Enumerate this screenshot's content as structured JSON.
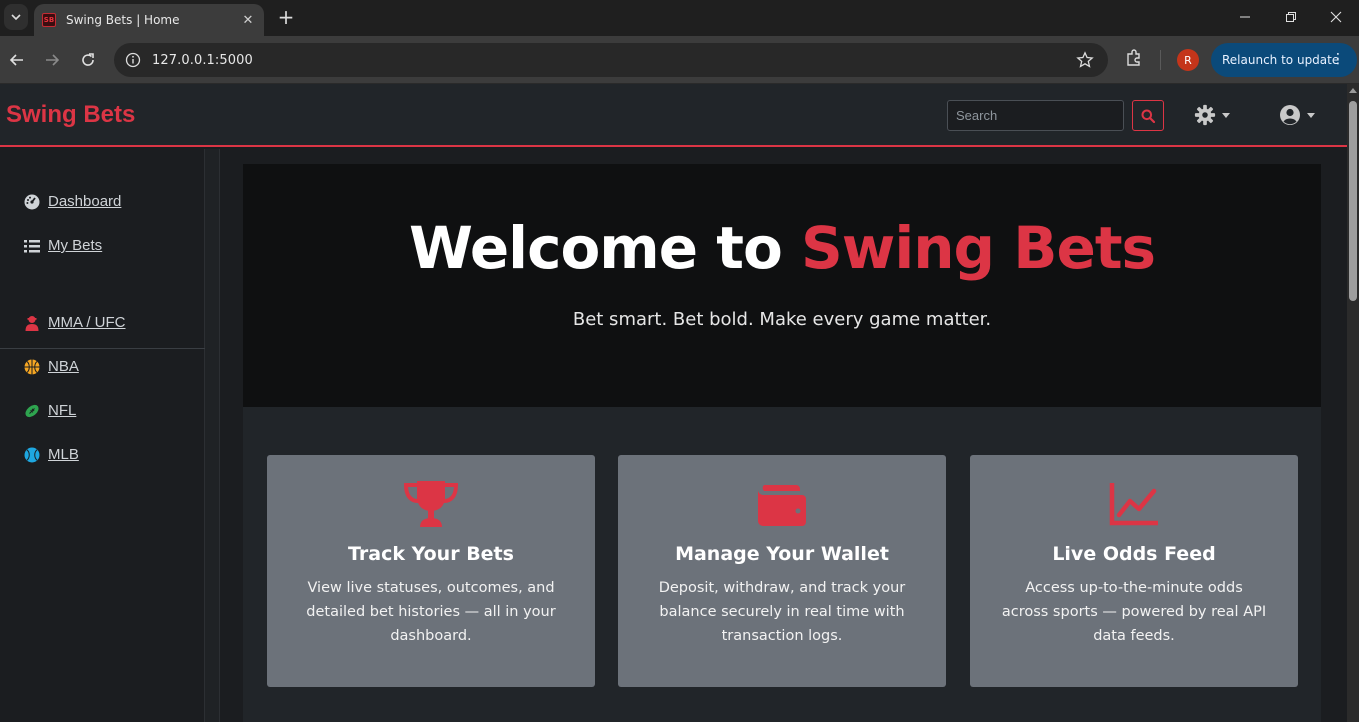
{
  "browser": {
    "tab_title": "Swing Bets | Home",
    "favicon_text": "SB",
    "url": "127.0.0.1:5000",
    "profile_initial": "R",
    "relaunch_label": "Relaunch to update"
  },
  "navbar": {
    "brand": "Swing Bets",
    "search_placeholder": "Search"
  },
  "sidebar": {
    "items": [
      {
        "label": " Dashboard",
        "icon": "gauge-icon"
      },
      {
        "label": " My Bets",
        "icon": "list-icon"
      },
      {
        "label": " MMA / UFC",
        "icon": "fighter-icon",
        "color": "#dc3545"
      },
      {
        "label": " NBA",
        "icon": "basketball-icon",
        "color": "#f5a623"
      },
      {
        "label": " NFL",
        "icon": "football-icon",
        "color": "#2ea44f"
      },
      {
        "label": " MLB",
        "icon": "baseball-icon",
        "color": "#1ea7e0"
      }
    ]
  },
  "hero": {
    "title_prefix": "Welcome to ",
    "title_accent": "Swing Bets",
    "subtitle": "Bet smart. Bet bold. Make every game matter."
  },
  "features": [
    {
      "icon": "trophy-icon",
      "title": "Track Your Bets",
      "text": "View live statuses, outcomes, and detailed bet histories — all in your dashboard."
    },
    {
      "icon": "wallet-icon",
      "title": "Manage Your Wallet",
      "text": "Deposit, withdraw, and track your balance securely in real time with transaction logs."
    },
    {
      "icon": "chart-line-icon",
      "title": "Live Odds Feed",
      "text": "Access up-to-the-minute odds across sports — powered by real API data feeds."
    }
  ],
  "colors": {
    "accent": "#dc3545",
    "navbar_bg": "#212529",
    "card_bg": "#6c727a"
  }
}
